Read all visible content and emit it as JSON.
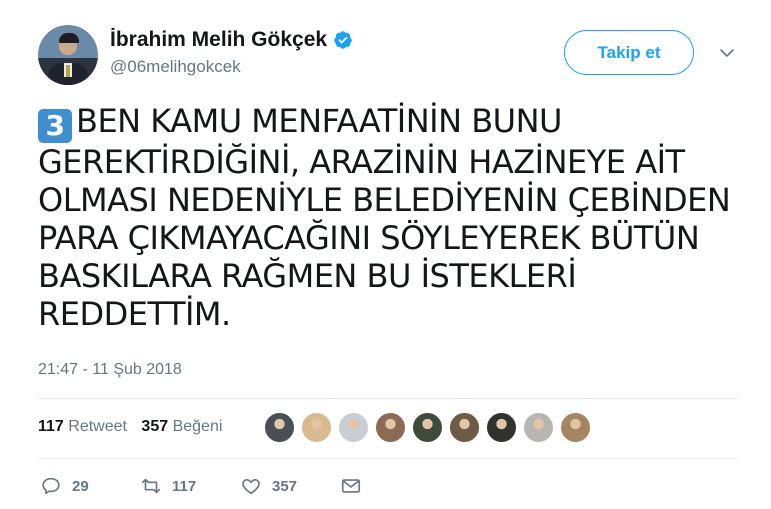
{
  "author": {
    "name": "İbrahim Melih Gökçek",
    "handle": "@06melihgokcek",
    "verified": true
  },
  "follow_button": {
    "label": "Takip et"
  },
  "tweet": {
    "emoji_keycap": "3",
    "text": "BEN KAMU MENFAATİNİN BUNU GEREKTİRDİĞİNİ, ARAZİNİN HAZİNEYE AİT OLMASI NEDENİYLE BELEDİYENİN ÇEBİNDEN PARA ÇIKMAYACAĞINI SÖYLEYEREK BÜTÜN BASKILARA RAĞMEN BU İSTEKLERİ REDDETTİM.",
    "timestamp": "21:47 - 11 Şub 2018"
  },
  "stats": {
    "retweet_count": "117",
    "retweet_label": "Retweet",
    "like_count": "357",
    "like_label": "Beğeni"
  },
  "likers": [
    {
      "color": "#4a4f57"
    },
    {
      "color": "#d9b98f"
    },
    {
      "color": "#c8ced4"
    },
    {
      "color": "#8c6b55"
    },
    {
      "color": "#3e4a3a"
    },
    {
      "color": "#6d5a47"
    },
    {
      "color": "#2f3431"
    },
    {
      "color": "#b9b6b2"
    },
    {
      "color": "#a58660"
    }
  ],
  "actions": {
    "reply_count": "29",
    "retweet_count": "117",
    "like_count": "357"
  },
  "colors": {
    "accent": "#1da1f2",
    "keycap": "#3e8ed0",
    "secondary_text": "#657786"
  }
}
